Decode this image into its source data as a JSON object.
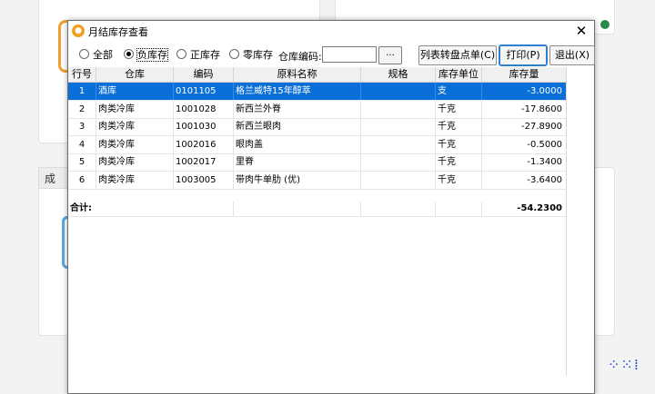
{
  "background": {
    "tab_label": "成本"
  },
  "dialog": {
    "title": "月结库存查看",
    "close_glyph": "✕"
  },
  "filters": {
    "options": [
      "全部",
      "负库存",
      "正库存",
      "零库存"
    ],
    "selected": "负库存",
    "warehouse_code_label": "仓库编码:",
    "warehouse_code_value": "",
    "browse_label": "..."
  },
  "buttons": {
    "to_stocktake": "列表转盘点单(C)",
    "print": "打印(P)",
    "exit": "退出(X)"
  },
  "table": {
    "columns": [
      "行号",
      "仓库",
      "编码",
      "原料名称",
      "规格",
      "库存单位",
      "库存量"
    ],
    "rows": [
      {
        "no": "1",
        "warehouse": "酒库",
        "code": "0101105",
        "name": "格兰威特15年醇萃",
        "spec": "",
        "unit": "支",
        "qty": "-3.0000"
      },
      {
        "no": "2",
        "warehouse": "肉类冷库",
        "code": "1001028",
        "name": "新西兰外脊",
        "spec": "",
        "unit": "千克",
        "qty": "-17.8600"
      },
      {
        "no": "3",
        "warehouse": "肉类冷库",
        "code": "1001030",
        "name": "新西兰眼肉",
        "spec": "",
        "unit": "千克",
        "qty": "-27.8900"
      },
      {
        "no": "4",
        "warehouse": "肉类冷库",
        "code": "1002016",
        "name": "眼肉盖",
        "spec": "",
        "unit": "千克",
        "qty": "-0.5000"
      },
      {
        "no": "5",
        "warehouse": "肉类冷库",
        "code": "1002017",
        "name": "里脊",
        "spec": "",
        "unit": "千克",
        "qty": "-1.3400"
      },
      {
        "no": "6",
        "warehouse": "肉类冷库",
        "code": "1003005",
        "name": "带肉牛单肋 (优)",
        "spec": "",
        "unit": "千克",
        "qty": "-3.6400"
      }
    ],
    "total_label": "合计:",
    "total_qty": "-54.2300",
    "selected_row": 0
  },
  "colors": {
    "selection": "#0a6fd8",
    "accent_orange": "#f0a030",
    "accent_blue": "#5aa8e6"
  }
}
